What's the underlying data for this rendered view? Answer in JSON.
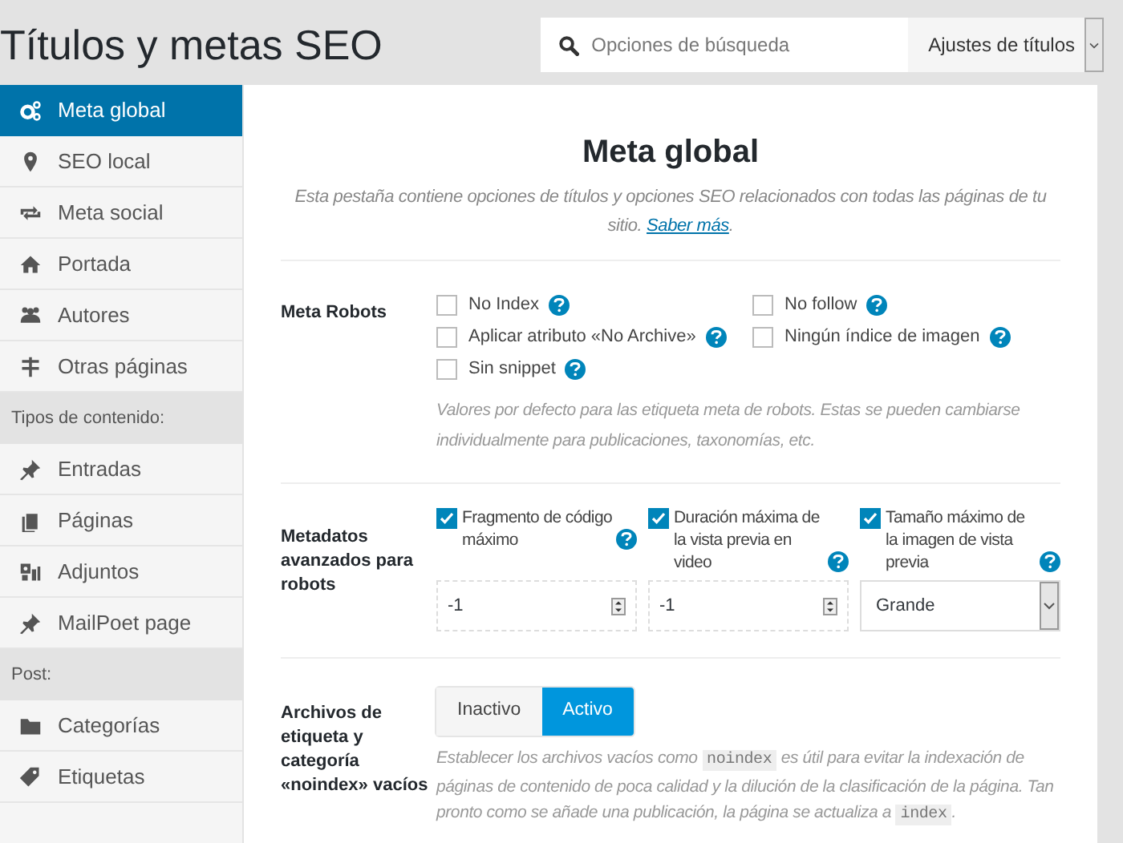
{
  "header": {
    "title": "Títulos y metas SEO",
    "search": {
      "placeholder": "Opciones de búsqueda"
    },
    "dropdown": {
      "value": "Ajustes de títulos"
    }
  },
  "sidebar": {
    "items": [
      {
        "kind": "item",
        "label": "Meta global",
        "selected": true
      },
      {
        "kind": "item",
        "label": "SEO local",
        "selected": false
      },
      {
        "kind": "item",
        "label": "Meta social",
        "selected": false
      },
      {
        "kind": "item",
        "label": "Portada",
        "selected": false
      },
      {
        "kind": "item",
        "label": "Autores",
        "selected": false
      },
      {
        "kind": "item",
        "label": "Otras páginas",
        "selected": false
      },
      {
        "kind": "heading",
        "label": "Tipos de contenido:"
      },
      {
        "kind": "item",
        "label": "Entradas",
        "selected": false
      },
      {
        "kind": "item",
        "label": "Páginas",
        "selected": false
      },
      {
        "kind": "item",
        "label": "Adjuntos",
        "selected": false
      },
      {
        "kind": "item",
        "label": "MailPoet page",
        "selected": false
      },
      {
        "kind": "heading",
        "label": "Post:"
      },
      {
        "kind": "item",
        "label": "Categorías",
        "selected": false
      },
      {
        "kind": "item",
        "label": "Etiquetas",
        "selected": false
      }
    ]
  },
  "panel": {
    "title": "Meta global",
    "description": "Esta pestaña contiene opciones de títulos y opciones SEO relacionados con todas las páginas de tu sitio.",
    "link": "Saber más",
    "description_end": ".",
    "meta_robots": {
      "label": "Meta Robots",
      "options": [
        {
          "label": "No Index",
          "checked": false
        },
        {
          "label": "No follow",
          "checked": false
        },
        {
          "label": "Aplicar atributo «No Archive»",
          "checked": false
        },
        {
          "label": "Ningún índice de imagen",
          "checked": false
        },
        {
          "label": "Sin snippet",
          "checked": false
        }
      ],
      "hint": "Valores por defecto para las etiqueta meta de robots. Estas se pueden cambiarse individualmente para publicaciones, taxonomías, etc."
    },
    "advanced": {
      "label": "Metadatos avanzados para robots",
      "fields": [
        {
          "kind": "number",
          "label": "Fragmento de código máximo",
          "checked": true,
          "value": "-1"
        },
        {
          "kind": "number",
          "label": "Duración máxima de la vista previa en video",
          "checked": true,
          "value": "-1"
        },
        {
          "kind": "select",
          "label": "Tamaño máximo de la imagen de vista previa",
          "checked": true,
          "value": "Grande"
        }
      ]
    },
    "noindex_archives": {
      "label": "Archivos de etiqueta y categoría «noindex» vacíos",
      "options": [
        {
          "label": "Inactivo",
          "selected": false
        },
        {
          "label": "Activo",
          "selected": true
        }
      ],
      "hint": [
        {
          "kind": "text",
          "text": "Establecer los archivos vacíos como "
        },
        {
          "kind": "code",
          "text": "noindex"
        },
        {
          "kind": "text",
          "text": " es útil para evitar la indexación de páginas de contenido de poca calidad y la dilución de la clasificación de la página. Tan pronto como se añade una publicación, la página se actualiza a "
        },
        {
          "kind": "code",
          "text": "index"
        },
        {
          "kind": "text",
          "text": "."
        }
      ]
    }
  }
}
